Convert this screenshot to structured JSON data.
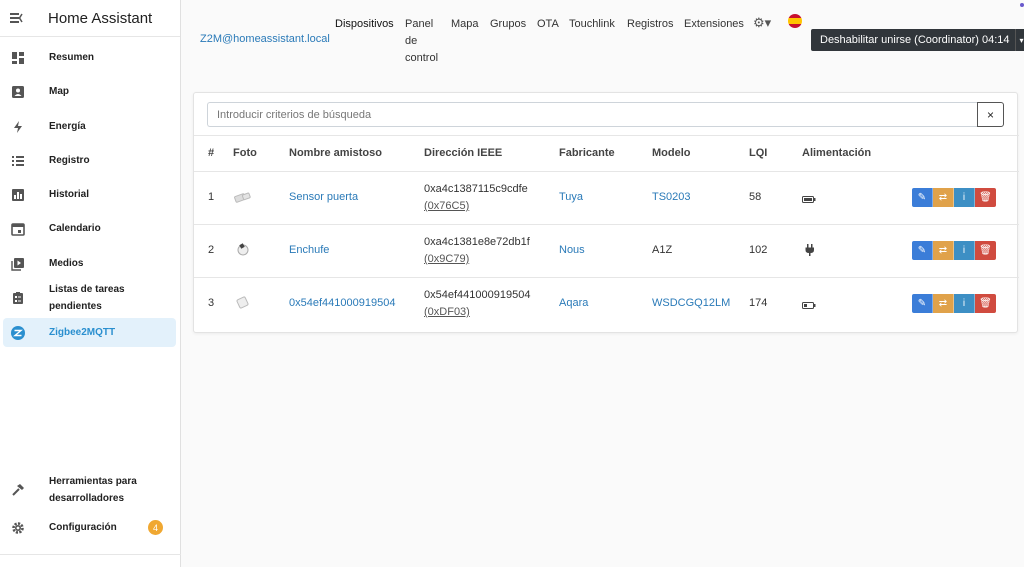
{
  "sidebar": {
    "title": "Home Assistant",
    "items": [
      {
        "label": "Resumen",
        "icon": "dashboard-icon"
      },
      {
        "label": "Map",
        "icon": "map-person-icon"
      },
      {
        "label": "Energía",
        "icon": "lightning-icon"
      },
      {
        "label": "Registro",
        "icon": "list-icon"
      },
      {
        "label": "Historial",
        "icon": "bar-chart-icon"
      },
      {
        "label": "Calendario",
        "icon": "calendar-icon"
      },
      {
        "label": "Medios",
        "icon": "media-icon"
      },
      {
        "label": "Listas de tareas pendientes",
        "icon": "clipboard-icon"
      },
      {
        "label": "Zigbee2MQTT",
        "icon": "zigbee-icon",
        "active": true
      }
    ],
    "dev_tools_label": "Herramientas para desarrolladores",
    "settings_label": "Configuración",
    "settings_badge": "4"
  },
  "topbar": {
    "host": "Z2M@homeassistant.local",
    "nav": [
      "Dispositivos",
      "Panel de control",
      "Mapa",
      "Grupos",
      "OTA",
      "Touchlink",
      "Registros",
      "Extensiones"
    ],
    "join_button": "Deshabilitar unirse (Coordinator) 04:14"
  },
  "search": {
    "placeholder": "Introducir criterios de búsqueda",
    "clear_label": "×"
  },
  "table": {
    "headers": [
      "#",
      "Foto",
      "Nombre amistoso",
      "Dirección IEEE",
      "Fabricante",
      "Modelo",
      "LQI",
      "Alimentación"
    ],
    "rows": [
      {
        "index": "1",
        "name": "Sensor puerta",
        "ieee": "0xa4c1387115c9cdfe",
        "nwk": "(0x76C5)",
        "manufacturer": "Tuya",
        "model": "TS0203",
        "lqi": "58",
        "power_icon": "battery-full-icon"
      },
      {
        "index": "2",
        "name": "Enchufe",
        "ieee": "0xa4c1381e8e72db1f",
        "nwk": "(0x9C79)",
        "manufacturer": "Nous",
        "model": "A1Z",
        "lqi": "102",
        "power_icon": "plug-icon"
      },
      {
        "index": "3",
        "name": "0x54ef441000919504",
        "ieee": "0x54ef441000919504",
        "nwk": "(0xDF03)",
        "manufacturer": "Aqara",
        "model": "WSDCGQ12LM",
        "lqi": "174",
        "power_icon": "battery-half-icon"
      }
    ]
  },
  "colors": {
    "accent": "#2a8fcf",
    "link": "#2a7ab8",
    "edit": "#3b7dd8",
    "rename": "#e0a24a",
    "info": "#3d8fc4",
    "remove": "#d04b3f"
  }
}
